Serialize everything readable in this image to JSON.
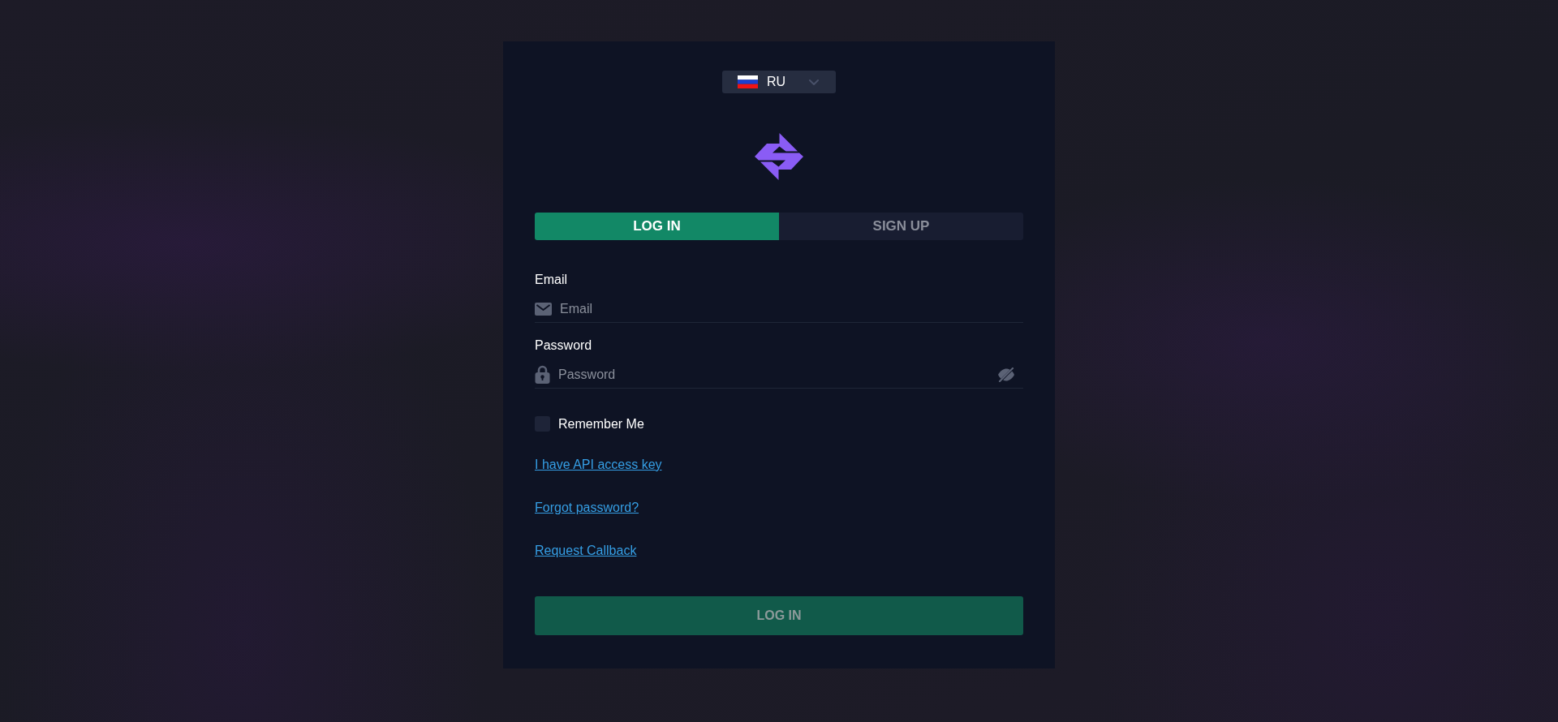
{
  "language_selector": {
    "code": "RU"
  },
  "tabs": [
    {
      "label": "LOG IN",
      "selected": true
    },
    {
      "label": "SIGN UP",
      "selected": false
    }
  ],
  "fields": [
    {
      "kind": "email",
      "label": "Email",
      "placeholder": "Email"
    },
    {
      "kind": "password",
      "label": "Password",
      "placeholder": "Password"
    }
  ],
  "remember_me": {
    "label": "Remember Me",
    "checked": false
  },
  "links": [
    "I have API access key",
    "Forgot password?",
    "Request Callback"
  ],
  "submit_button": {
    "label": "LOG IN",
    "disabled": true
  }
}
